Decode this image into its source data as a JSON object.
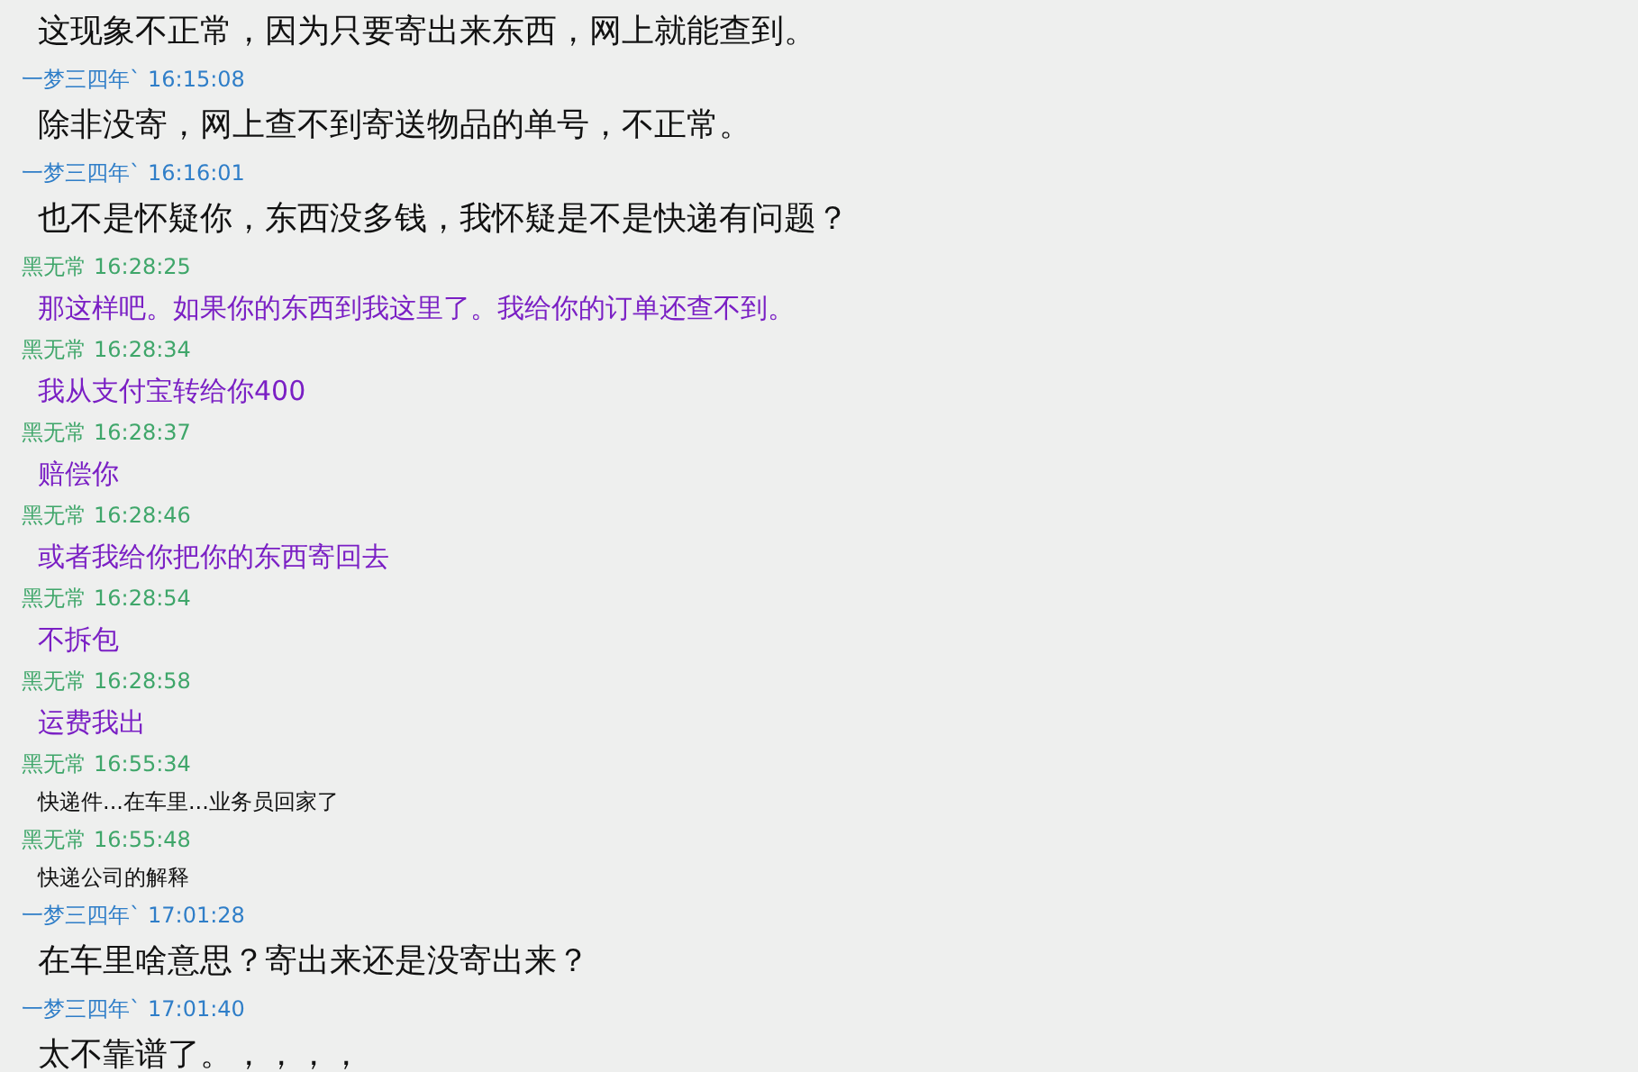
{
  "messages": [
    {
      "kind": "large",
      "text": "这现象不正常，因为只要寄出来东西，网上就能查到。"
    },
    {
      "sender": "一梦三四年`",
      "time": "16:15:08",
      "color": "#2f7ec8",
      "kind": "large",
      "text": "除非没寄，网上查不到寄送物品的单号，不正常。"
    },
    {
      "sender": "一梦三四年`",
      "time": "16:16:01",
      "color": "#2f7ec8",
      "kind": "large",
      "text": "也不是怀疑你，东西没多钱，我怀疑是不是快递有问题？"
    },
    {
      "sender": "黑无常",
      "time": "16:28:25",
      "color": "#3fa66a",
      "kind": "purple",
      "text": "那这样吧。如果你的东西到我这里了。我给你的订单还查不到。"
    },
    {
      "sender": "黑无常",
      "time": "16:28:34",
      "color": "#3fa66a",
      "kind": "purple",
      "text": "我从支付宝转给你400"
    },
    {
      "sender": "黑无常",
      "time": "16:28:37",
      "color": "#3fa66a",
      "kind": "purple",
      "text": "赔偿你"
    },
    {
      "sender": "黑无常",
      "time": "16:28:46",
      "color": "#3fa66a",
      "kind": "purple",
      "text": "或者我给你把你的东西寄回去"
    },
    {
      "sender": "黑无常",
      "time": "16:28:54",
      "color": "#3fa66a",
      "kind": "purple",
      "text": "不拆包"
    },
    {
      "sender": "黑无常",
      "time": "16:28:58",
      "color": "#3fa66a",
      "kind": "purple",
      "text": "运费我出"
    },
    {
      "sender": "黑无常",
      "time": "16:55:34",
      "color": "#3fa66a",
      "kind": "small",
      "text": "快递件...在车里...业务员回家了"
    },
    {
      "sender": "黑无常",
      "time": "16:55:48",
      "color": "#3fa66a",
      "kind": "small",
      "text": "快递公司的解释"
    },
    {
      "sender": "一梦三四年`",
      "time": "17:01:28",
      "color": "#2f7ec8",
      "kind": "large",
      "text": "在车里啥意思？寄出来还是没寄出来？"
    },
    {
      "sender": "一梦三四年`",
      "time": "17:01:40",
      "color": "#2f7ec8",
      "kind": "large",
      "text": "太不靠谱了。，，，，"
    }
  ]
}
